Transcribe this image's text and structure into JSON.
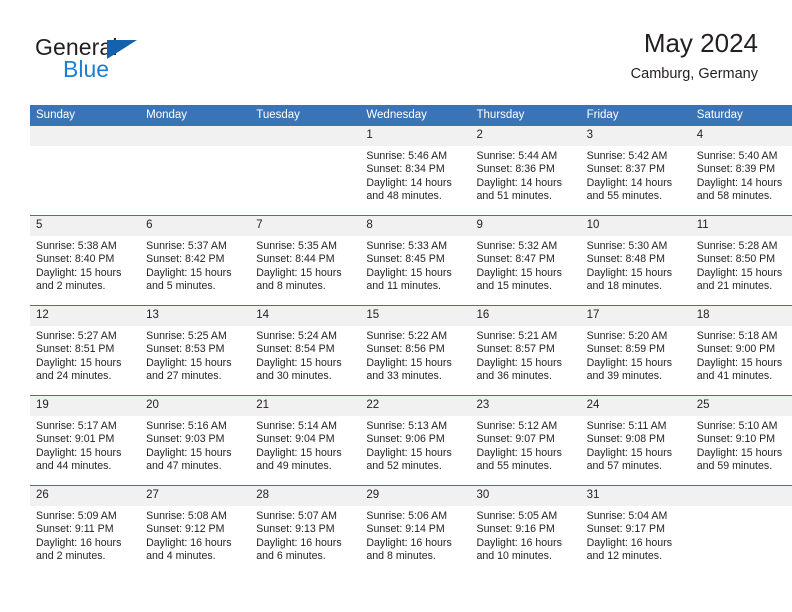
{
  "brand": {
    "line1": "General",
    "line2": "Blue",
    "icon": "triangle-logo"
  },
  "header": {
    "title": "May 2024",
    "subtitle": "Camburg, Germany"
  },
  "calendar": {
    "weekday_headers": [
      "Sunday",
      "Monday",
      "Tuesday",
      "Wednesday",
      "Thursday",
      "Friday",
      "Saturday"
    ],
    "accent_color": "#3b74b6",
    "daynum_bg": "#f1f1f1",
    "weeks": [
      [
        {
          "day": "",
          "sunrise": "",
          "sunset": "",
          "daylight1": "",
          "daylight2": ""
        },
        {
          "day": "",
          "sunrise": "",
          "sunset": "",
          "daylight1": "",
          "daylight2": ""
        },
        {
          "day": "",
          "sunrise": "",
          "sunset": "",
          "daylight1": "",
          "daylight2": ""
        },
        {
          "day": "1",
          "sunrise": "Sunrise: 5:46 AM",
          "sunset": "Sunset: 8:34 PM",
          "daylight1": "Daylight: 14 hours",
          "daylight2": "and 48 minutes."
        },
        {
          "day": "2",
          "sunrise": "Sunrise: 5:44 AM",
          "sunset": "Sunset: 8:36 PM",
          "daylight1": "Daylight: 14 hours",
          "daylight2": "and 51 minutes."
        },
        {
          "day": "3",
          "sunrise": "Sunrise: 5:42 AM",
          "sunset": "Sunset: 8:37 PM",
          "daylight1": "Daylight: 14 hours",
          "daylight2": "and 55 minutes."
        },
        {
          "day": "4",
          "sunrise": "Sunrise: 5:40 AM",
          "sunset": "Sunset: 8:39 PM",
          "daylight1": "Daylight: 14 hours",
          "daylight2": "and 58 minutes."
        }
      ],
      [
        {
          "day": "5",
          "sunrise": "Sunrise: 5:38 AM",
          "sunset": "Sunset: 8:40 PM",
          "daylight1": "Daylight: 15 hours",
          "daylight2": "and 2 minutes."
        },
        {
          "day": "6",
          "sunrise": "Sunrise: 5:37 AM",
          "sunset": "Sunset: 8:42 PM",
          "daylight1": "Daylight: 15 hours",
          "daylight2": "and 5 minutes."
        },
        {
          "day": "7",
          "sunrise": "Sunrise: 5:35 AM",
          "sunset": "Sunset: 8:44 PM",
          "daylight1": "Daylight: 15 hours",
          "daylight2": "and 8 minutes."
        },
        {
          "day": "8",
          "sunrise": "Sunrise: 5:33 AM",
          "sunset": "Sunset: 8:45 PM",
          "daylight1": "Daylight: 15 hours",
          "daylight2": "and 11 minutes."
        },
        {
          "day": "9",
          "sunrise": "Sunrise: 5:32 AM",
          "sunset": "Sunset: 8:47 PM",
          "daylight1": "Daylight: 15 hours",
          "daylight2": "and 15 minutes."
        },
        {
          "day": "10",
          "sunrise": "Sunrise: 5:30 AM",
          "sunset": "Sunset: 8:48 PM",
          "daylight1": "Daylight: 15 hours",
          "daylight2": "and 18 minutes."
        },
        {
          "day": "11",
          "sunrise": "Sunrise: 5:28 AM",
          "sunset": "Sunset: 8:50 PM",
          "daylight1": "Daylight: 15 hours",
          "daylight2": "and 21 minutes."
        }
      ],
      [
        {
          "day": "12",
          "sunrise": "Sunrise: 5:27 AM",
          "sunset": "Sunset: 8:51 PM",
          "daylight1": "Daylight: 15 hours",
          "daylight2": "and 24 minutes."
        },
        {
          "day": "13",
          "sunrise": "Sunrise: 5:25 AM",
          "sunset": "Sunset: 8:53 PM",
          "daylight1": "Daylight: 15 hours",
          "daylight2": "and 27 minutes."
        },
        {
          "day": "14",
          "sunrise": "Sunrise: 5:24 AM",
          "sunset": "Sunset: 8:54 PM",
          "daylight1": "Daylight: 15 hours",
          "daylight2": "and 30 minutes."
        },
        {
          "day": "15",
          "sunrise": "Sunrise: 5:22 AM",
          "sunset": "Sunset: 8:56 PM",
          "daylight1": "Daylight: 15 hours",
          "daylight2": "and 33 minutes."
        },
        {
          "day": "16",
          "sunrise": "Sunrise: 5:21 AM",
          "sunset": "Sunset: 8:57 PM",
          "daylight1": "Daylight: 15 hours",
          "daylight2": "and 36 minutes."
        },
        {
          "day": "17",
          "sunrise": "Sunrise: 5:20 AM",
          "sunset": "Sunset: 8:59 PM",
          "daylight1": "Daylight: 15 hours",
          "daylight2": "and 39 minutes."
        },
        {
          "day": "18",
          "sunrise": "Sunrise: 5:18 AM",
          "sunset": "Sunset: 9:00 PM",
          "daylight1": "Daylight: 15 hours",
          "daylight2": "and 41 minutes."
        }
      ],
      [
        {
          "day": "19",
          "sunrise": "Sunrise: 5:17 AM",
          "sunset": "Sunset: 9:01 PM",
          "daylight1": "Daylight: 15 hours",
          "daylight2": "and 44 minutes."
        },
        {
          "day": "20",
          "sunrise": "Sunrise: 5:16 AM",
          "sunset": "Sunset: 9:03 PM",
          "daylight1": "Daylight: 15 hours",
          "daylight2": "and 47 minutes."
        },
        {
          "day": "21",
          "sunrise": "Sunrise: 5:14 AM",
          "sunset": "Sunset: 9:04 PM",
          "daylight1": "Daylight: 15 hours",
          "daylight2": "and 49 minutes."
        },
        {
          "day": "22",
          "sunrise": "Sunrise: 5:13 AM",
          "sunset": "Sunset: 9:06 PM",
          "daylight1": "Daylight: 15 hours",
          "daylight2": "and 52 minutes."
        },
        {
          "day": "23",
          "sunrise": "Sunrise: 5:12 AM",
          "sunset": "Sunset: 9:07 PM",
          "daylight1": "Daylight: 15 hours",
          "daylight2": "and 55 minutes."
        },
        {
          "day": "24",
          "sunrise": "Sunrise: 5:11 AM",
          "sunset": "Sunset: 9:08 PM",
          "daylight1": "Daylight: 15 hours",
          "daylight2": "and 57 minutes."
        },
        {
          "day": "25",
          "sunrise": "Sunrise: 5:10 AM",
          "sunset": "Sunset: 9:10 PM",
          "daylight1": "Daylight: 15 hours",
          "daylight2": "and 59 minutes."
        }
      ],
      [
        {
          "day": "26",
          "sunrise": "Sunrise: 5:09 AM",
          "sunset": "Sunset: 9:11 PM",
          "daylight1": "Daylight: 16 hours",
          "daylight2": "and 2 minutes."
        },
        {
          "day": "27",
          "sunrise": "Sunrise: 5:08 AM",
          "sunset": "Sunset: 9:12 PM",
          "daylight1": "Daylight: 16 hours",
          "daylight2": "and 4 minutes."
        },
        {
          "day": "28",
          "sunrise": "Sunrise: 5:07 AM",
          "sunset": "Sunset: 9:13 PM",
          "daylight1": "Daylight: 16 hours",
          "daylight2": "and 6 minutes."
        },
        {
          "day": "29",
          "sunrise": "Sunrise: 5:06 AM",
          "sunset": "Sunset: 9:14 PM",
          "daylight1": "Daylight: 16 hours",
          "daylight2": "and 8 minutes."
        },
        {
          "day": "30",
          "sunrise": "Sunrise: 5:05 AM",
          "sunset": "Sunset: 9:16 PM",
          "daylight1": "Daylight: 16 hours",
          "daylight2": "and 10 minutes."
        },
        {
          "day": "31",
          "sunrise": "Sunrise: 5:04 AM",
          "sunset": "Sunset: 9:17 PM",
          "daylight1": "Daylight: 16 hours",
          "daylight2": "and 12 minutes."
        },
        {
          "day": "",
          "sunrise": "",
          "sunset": "",
          "daylight1": "",
          "daylight2": ""
        }
      ]
    ]
  }
}
